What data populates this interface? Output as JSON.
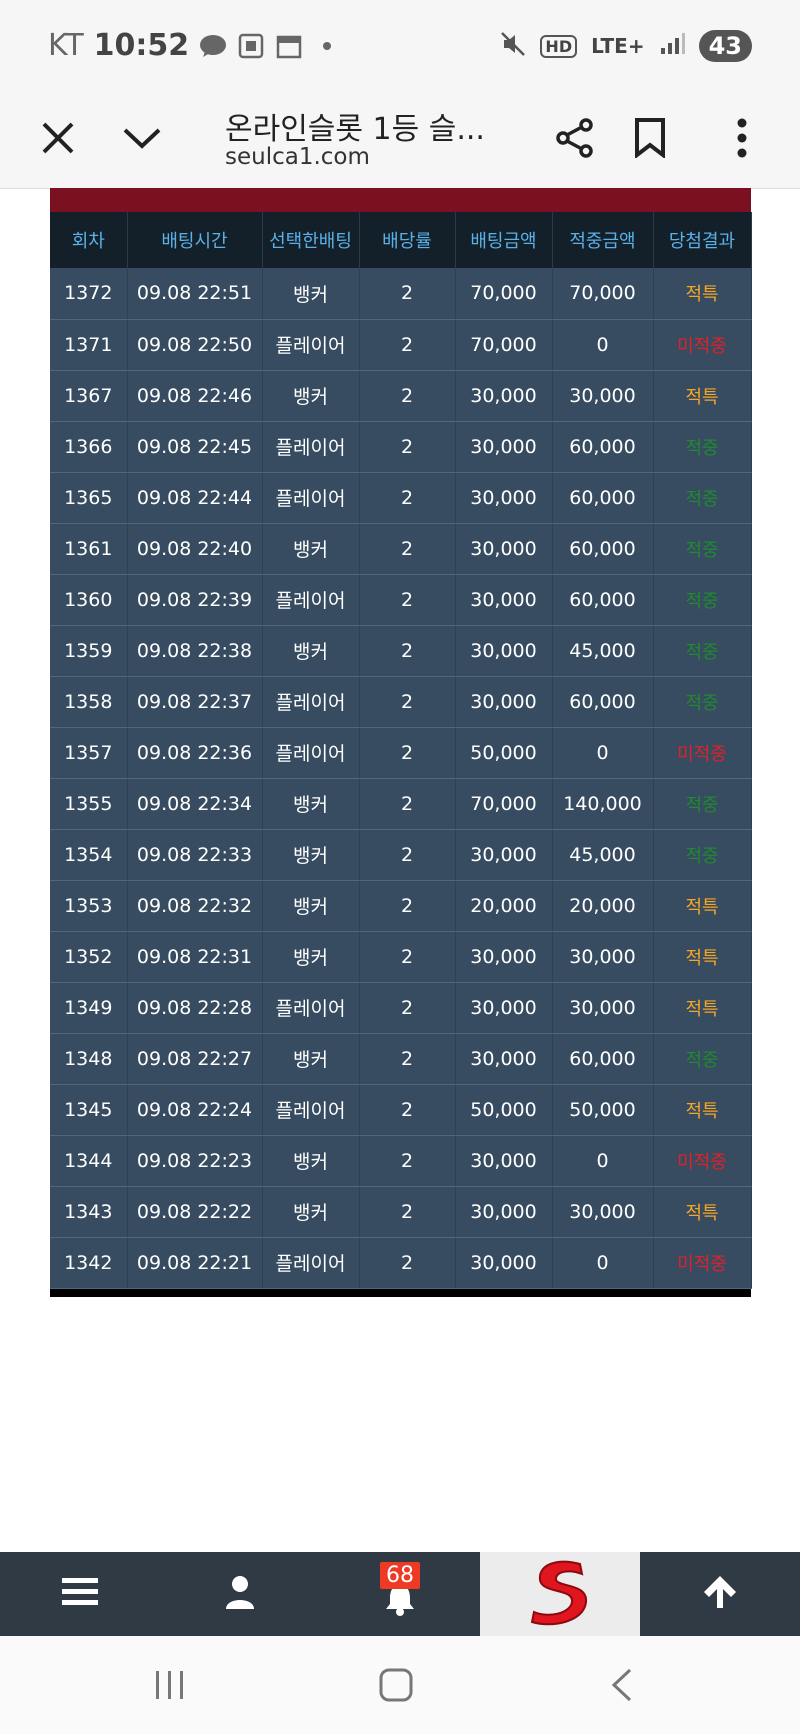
{
  "status_bar": {
    "carrier": "KT",
    "time": "10:52",
    "icons_left": [
      "talk-icon",
      "screenshot-icon",
      "calendar-icon",
      "dot-icon"
    ],
    "icons_right": [
      "mute-icon",
      "hd-icon",
      "lte-icon",
      "signal-icon"
    ],
    "lte_label": "LTE+",
    "hd_label": "HD",
    "battery": "43"
  },
  "browser": {
    "title": "온라인슬롯 1등 슬...",
    "url": "seulca1.com"
  },
  "table": {
    "headers": [
      "회차",
      "배팅시간",
      "선택한배팅",
      "배당률",
      "배팅금액",
      "적중금액",
      "당첨결과"
    ],
    "rows": [
      {
        "round": "1372",
        "time": "09.08 22:51",
        "pick": "뱅커",
        "odds": "2",
        "bet": "70,000",
        "win": "70,000",
        "result": "적특",
        "result_type": "push"
      },
      {
        "round": "1371",
        "time": "09.08 22:50",
        "pick": "플레이어",
        "odds": "2",
        "bet": "70,000",
        "win": "0",
        "result": "미적중",
        "result_type": "lose"
      },
      {
        "round": "1367",
        "time": "09.08 22:46",
        "pick": "뱅커",
        "odds": "2",
        "bet": "30,000",
        "win": "30,000",
        "result": "적특",
        "result_type": "push"
      },
      {
        "round": "1366",
        "time": "09.08 22:45",
        "pick": "플레이어",
        "odds": "2",
        "bet": "30,000",
        "win": "60,000",
        "result": "적중",
        "result_type": "win"
      },
      {
        "round": "1365",
        "time": "09.08 22:44",
        "pick": "플레이어",
        "odds": "2",
        "bet": "30,000",
        "win": "60,000",
        "result": "적중",
        "result_type": "win"
      },
      {
        "round": "1361",
        "time": "09.08 22:40",
        "pick": "뱅커",
        "odds": "2",
        "bet": "30,000",
        "win": "60,000",
        "result": "적중",
        "result_type": "win"
      },
      {
        "round": "1360",
        "time": "09.08 22:39",
        "pick": "플레이어",
        "odds": "2",
        "bet": "30,000",
        "win": "60,000",
        "result": "적중",
        "result_type": "win"
      },
      {
        "round": "1359",
        "time": "09.08 22:38",
        "pick": "뱅커",
        "odds": "2",
        "bet": "30,000",
        "win": "45,000",
        "result": "적중",
        "result_type": "win"
      },
      {
        "round": "1358",
        "time": "09.08 22:37",
        "pick": "플레이어",
        "odds": "2",
        "bet": "30,000",
        "win": "60,000",
        "result": "적중",
        "result_type": "win"
      },
      {
        "round": "1357",
        "time": "09.08 22:36",
        "pick": "플레이어",
        "odds": "2",
        "bet": "50,000",
        "win": "0",
        "result": "미적중",
        "result_type": "lose"
      },
      {
        "round": "1355",
        "time": "09.08 22:34",
        "pick": "뱅커",
        "odds": "2",
        "bet": "70,000",
        "win": "140,000",
        "result": "적중",
        "result_type": "win"
      },
      {
        "round": "1354",
        "time": "09.08 22:33",
        "pick": "뱅커",
        "odds": "2",
        "bet": "30,000",
        "win": "45,000",
        "result": "적중",
        "result_type": "win"
      },
      {
        "round": "1353",
        "time": "09.08 22:32",
        "pick": "뱅커",
        "odds": "2",
        "bet": "20,000",
        "win": "20,000",
        "result": "적특",
        "result_type": "push"
      },
      {
        "round": "1352",
        "time": "09.08 22:31",
        "pick": "뱅커",
        "odds": "2",
        "bet": "30,000",
        "win": "30,000",
        "result": "적특",
        "result_type": "push"
      },
      {
        "round": "1349",
        "time": "09.08 22:28",
        "pick": "플레이어",
        "odds": "2",
        "bet": "30,000",
        "win": "30,000",
        "result": "적특",
        "result_type": "push"
      },
      {
        "round": "1348",
        "time": "09.08 22:27",
        "pick": "뱅커",
        "odds": "2",
        "bet": "30,000",
        "win": "60,000",
        "result": "적중",
        "result_type": "win"
      },
      {
        "round": "1345",
        "time": "09.08 22:24",
        "pick": "플레이어",
        "odds": "2",
        "bet": "50,000",
        "win": "50,000",
        "result": "적특",
        "result_type": "push"
      },
      {
        "round": "1344",
        "time": "09.08 22:23",
        "pick": "뱅커",
        "odds": "2",
        "bet": "30,000",
        "win": "0",
        "result": "미적중",
        "result_type": "lose"
      },
      {
        "round": "1343",
        "time": "09.08 22:22",
        "pick": "뱅커",
        "odds": "2",
        "bet": "30,000",
        "win": "30,000",
        "result": "적특",
        "result_type": "push"
      },
      {
        "round": "1342",
        "time": "09.08 22:21",
        "pick": "플레이어",
        "odds": "2",
        "bet": "30,000",
        "win": "0",
        "result": "미적중",
        "result_type": "lose"
      }
    ],
    "result_colors": {
      "push": "#f5a623",
      "lose": "#e0202a",
      "win": "#1f8a2e"
    }
  },
  "app_nav": {
    "items": [
      "menu-icon",
      "user-icon",
      "bell-icon",
      "logo",
      "arrow-up-icon"
    ],
    "notification_count": "68",
    "bg_color": "#2f3a45"
  },
  "system_nav": [
    "recents-icon",
    "home-icon",
    "back-icon"
  ]
}
